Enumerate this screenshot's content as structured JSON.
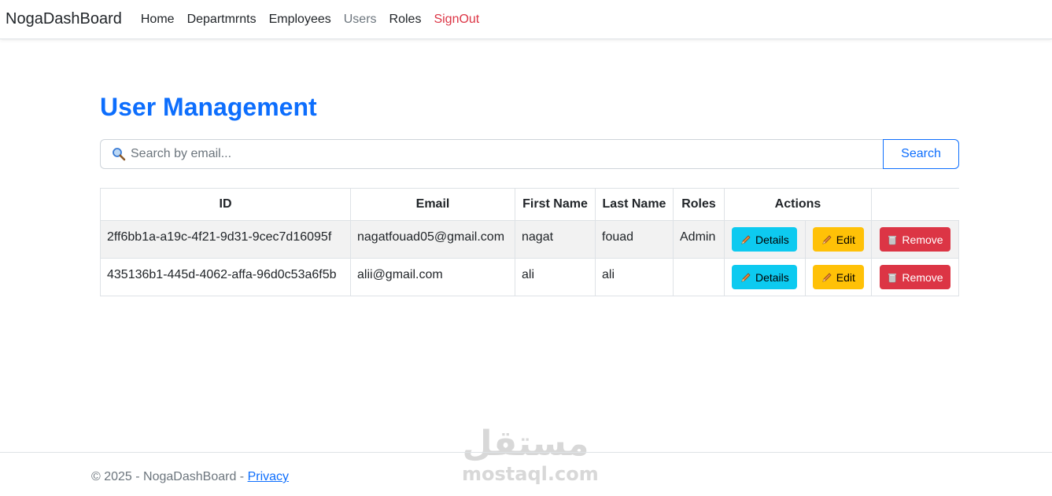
{
  "nav": {
    "brand": "NogaDashBoard",
    "links": [
      "Home",
      "Departmrnts",
      "Employees",
      "Users",
      "Roles",
      "SignOut"
    ]
  },
  "page": {
    "title": "User Management"
  },
  "search": {
    "placeholder": "Search by email...",
    "value": "",
    "button_label": "Search"
  },
  "table": {
    "headers": [
      "ID",
      "Email",
      "First Name",
      "Last Name",
      "Roles",
      "Actions",
      ""
    ],
    "rows": [
      {
        "id": "2ff6bb1a-a19c-4f21-9d31-9cec7d16095f",
        "email": "nagatfouad05@gmail.com",
        "first_name": "nagat",
        "last_name": "fouad",
        "roles": "Admin"
      },
      {
        "id": "435136b1-445d-4062-affa-96d0c53a6f5b",
        "email": "alii@gmail.com",
        "first_name": "ali",
        "last_name": "ali",
        "roles": ""
      }
    ],
    "actions": {
      "details": "Details",
      "edit": "Edit",
      "remove": "Remove"
    }
  },
  "footer": {
    "text": "© 2025 - NogaDashBoard -",
    "link": "Privacy"
  },
  "watermark": {
    "arabic": "مستقل",
    "latin": "mostaql.com"
  },
  "colors": {
    "primary": "#0d6efd",
    "info": "#0dcaf0",
    "warning": "#ffc107",
    "danger": "#dc3545",
    "muted": "#6c757d"
  }
}
